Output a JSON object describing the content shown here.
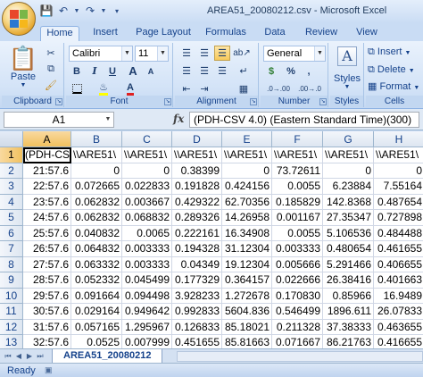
{
  "window": {
    "title": "AREA51_20080212.csv - Microsoft Excel"
  },
  "tabs": [
    "Home",
    "Insert",
    "Page Layout",
    "Formulas",
    "Data",
    "Review",
    "View"
  ],
  "ribbon": {
    "clipboard": {
      "label": "Clipboard",
      "paste": "Paste"
    },
    "font": {
      "label": "Font",
      "name": "Calibri",
      "size": "11",
      "bold": "B",
      "italic": "I",
      "underline": "U",
      "grow": "A",
      "shrink": "A",
      "color_glyph": "A"
    },
    "alignment": {
      "label": "Alignment"
    },
    "number": {
      "label": "Number",
      "format": "General",
      "currency": "$",
      "percent": "%",
      "comma": ",",
      "inc_dec": ".0→.00",
      "dec_dec": ".00→.0"
    },
    "styles": {
      "label": "Styles",
      "button": "Styles"
    },
    "cells": {
      "label": "Cells",
      "insert": "Insert",
      "delete": "Delete",
      "format": "Format"
    }
  },
  "formula_bar": {
    "name_box": "A1",
    "fx": "fx",
    "content": "(PDH-CSV 4.0) (Eastern Standard Time)(300)"
  },
  "grid": {
    "columns": [
      "A",
      "B",
      "C",
      "D",
      "E",
      "F",
      "G",
      "H"
    ],
    "rows": [
      {
        "n": "1",
        "cells": [
          "(PDH-CSV",
          "\\\\ARE51\\",
          "\\\\ARE51\\",
          "\\\\ARE51\\",
          "\\\\ARE51\\",
          "\\\\ARE51\\",
          "\\\\ARE51\\",
          "\\\\ARE51\\"
        ]
      },
      {
        "n": "2",
        "cells": [
          "21:57.6",
          "0",
          "0",
          "0.38399",
          "0",
          "73.72611",
          "0",
          "0"
        ]
      },
      {
        "n": "3",
        "cells": [
          "22:57.6",
          "0.072665",
          "0.022833",
          "0.191828",
          "0.424156",
          "0.0055",
          "6.23884",
          "7.55164"
        ]
      },
      {
        "n": "4",
        "cells": [
          "23:57.6",
          "0.062832",
          "0.003667",
          "0.429322",
          "62.70356",
          "0.185829",
          "142.8368",
          "0.487654"
        ]
      },
      {
        "n": "5",
        "cells": [
          "24:57.6",
          "0.062832",
          "0.068832",
          "0.289326",
          "14.26958",
          "0.001167",
          "27.35347",
          "0.727898"
        ]
      },
      {
        "n": "6",
        "cells": [
          "25:57.6",
          "0.040832",
          "0.0065",
          "0.222161",
          "16.34908",
          "0.0055",
          "5.106536",
          "0.484488"
        ]
      },
      {
        "n": "7",
        "cells": [
          "26:57.6",
          "0.064832",
          "0.003333",
          "0.194328",
          "31.12304",
          "0.003333",
          "0.480654",
          "0.461655"
        ]
      },
      {
        "n": "8",
        "cells": [
          "27:57.6",
          "0.063332",
          "0.003333",
          "0.04349",
          "19.12304",
          "0.005666",
          "5.291466",
          "0.406655"
        ]
      },
      {
        "n": "9",
        "cells": [
          "28:57.6",
          "0.052332",
          "0.045499",
          "0.177329",
          "0.364157",
          "0.022666",
          "26.38416",
          "0.401663"
        ]
      },
      {
        "n": "10",
        "cells": [
          "29:57.6",
          "0.091664",
          "0.094498",
          "3.928233",
          "1.272678",
          "0.170830",
          "0.85966",
          "16.9489"
        ]
      },
      {
        "n": "11",
        "cells": [
          "30:57.6",
          "0.029164",
          "0.949642",
          "0.992833",
          "5604.836",
          "0.546499",
          "1896.611",
          "26.07833"
        ]
      },
      {
        "n": "12",
        "cells": [
          "31:57.6",
          "0.057165",
          "1.295967",
          "0.126833",
          "85.18021",
          "0.211328",
          "37.38333",
          "0.463655"
        ]
      },
      {
        "n": "13",
        "cells": [
          "32:57.6",
          "0.0525",
          "0.007999",
          "0.451655",
          "85.81663",
          "0.071667",
          "86.21763",
          "0.416655"
        ]
      }
    ]
  },
  "sheet": {
    "tab": "AREA51_20080212"
  },
  "status": {
    "text": "Ready"
  }
}
